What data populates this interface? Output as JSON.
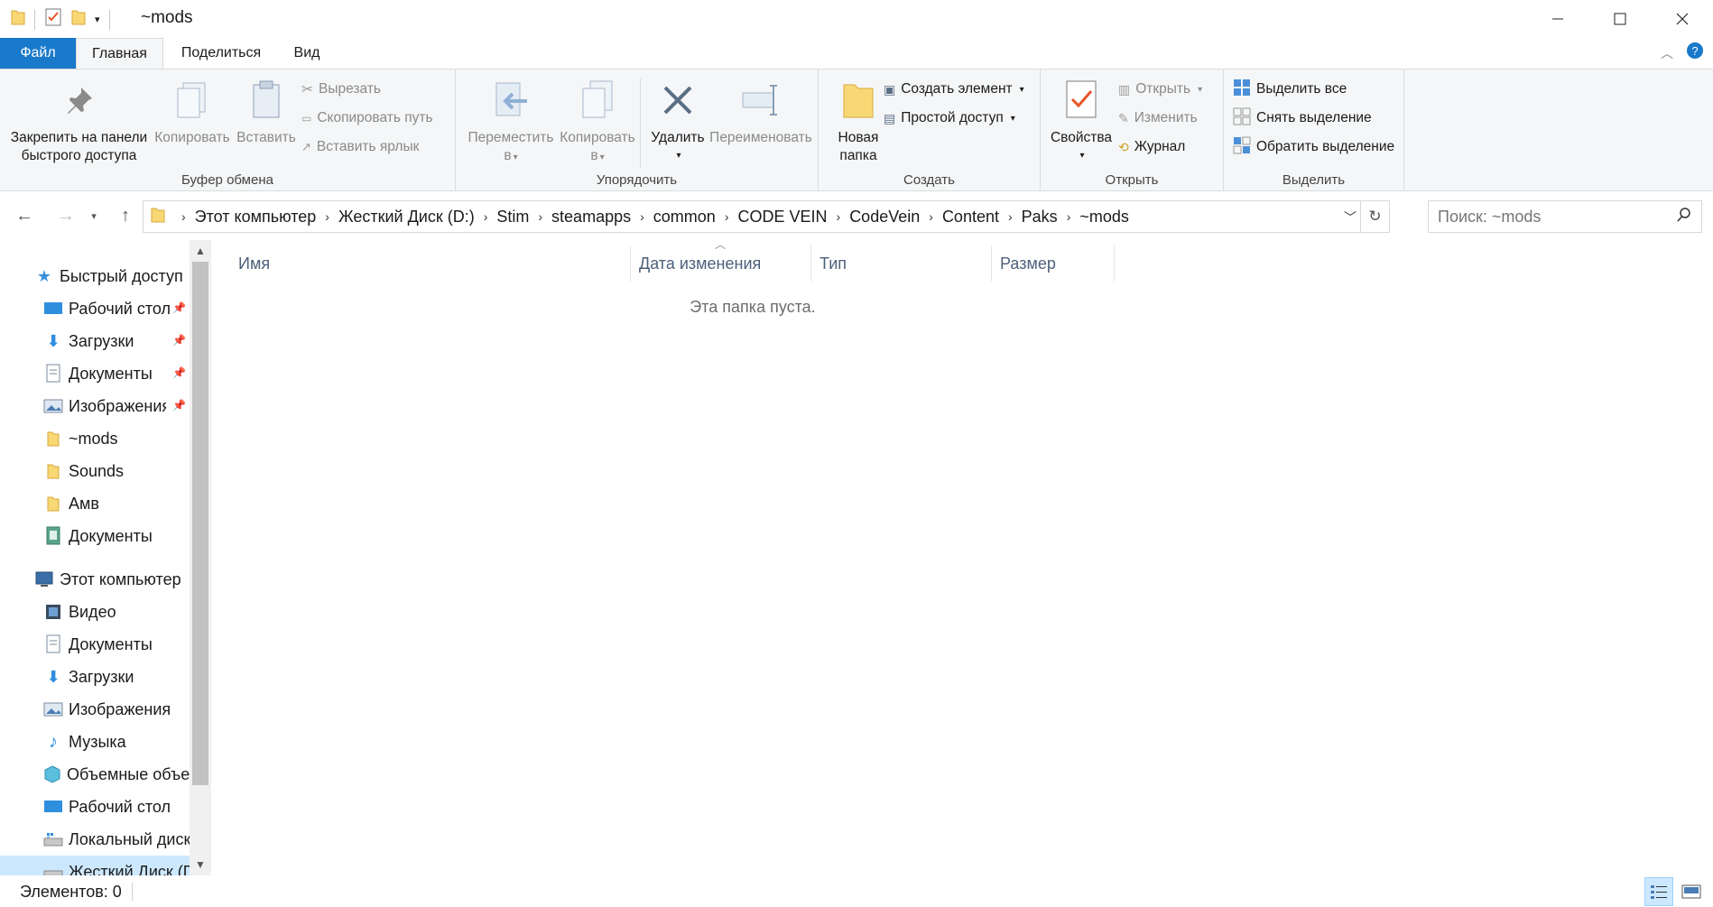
{
  "window": {
    "title": "~mods"
  },
  "tabs": {
    "file": "Файл",
    "home": "Главная",
    "share": "Поделиться",
    "view": "Вид"
  },
  "ribbon": {
    "clipboard": {
      "label": "Буфер обмена",
      "pin": "Закрепить на панели быстрого доступа",
      "pin_line1": "Закрепить на панели",
      "pin_line2": "быстрого доступа",
      "copy": "Копировать",
      "paste": "Вставить",
      "cut": "Вырезать",
      "copy_path": "Скопировать путь",
      "paste_shortcut": "Вставить ярлык"
    },
    "organize": {
      "label": "Упорядочить",
      "move_line1": "Переместить",
      "move_line2": "в",
      "copy_line1": "Копировать",
      "copy_line2": "в",
      "delete": "Удалить",
      "rename": "Переименовать"
    },
    "new": {
      "label": "Создать",
      "folder_line1": "Новая",
      "folder_line2": "папка",
      "new_item": "Создать элемент",
      "easy_access": "Простой доступ"
    },
    "open": {
      "label": "Открыть",
      "properties": "Свойства",
      "open": "Открыть",
      "edit": "Изменить",
      "history": "Журнал"
    },
    "select": {
      "label": "Выделить",
      "select_all": "Выделить все",
      "select_none": "Снять выделение",
      "invert": "Обратить выделение"
    }
  },
  "address": {
    "crumbs": [
      "Этот компьютер",
      "Жесткий Диск (D:)",
      "Stim",
      "steamapps",
      "common",
      "CODE VEIN",
      "CodeVein",
      "Content",
      "Paks",
      "~mods"
    ]
  },
  "search": {
    "placeholder": "Поиск: ~mods"
  },
  "nav": {
    "quick_access": "Быстрый доступ",
    "quick_items": [
      "Рабочий стол",
      "Загрузки",
      "Документы",
      "Изображения",
      "~mods",
      "Sounds",
      "Амв",
      "Документы"
    ],
    "this_pc": "Этот компьютер",
    "pc_items": [
      "Видео",
      "Документы",
      "Загрузки",
      "Изображения",
      "Музыка",
      "Объемные объекты",
      "Рабочий стол",
      "Локальный диск",
      "Жесткий Диск (D:)"
    ]
  },
  "columns": {
    "name": "Имя",
    "date": "Дата изменения",
    "type": "Тип",
    "size": "Размер"
  },
  "content": {
    "empty_message": "Эта папка пуста."
  },
  "status": {
    "items": "Элементов: 0"
  },
  "colors": {
    "accent": "#1979ca",
    "folder": "#f8d775",
    "column_header": "#4c607a"
  }
}
